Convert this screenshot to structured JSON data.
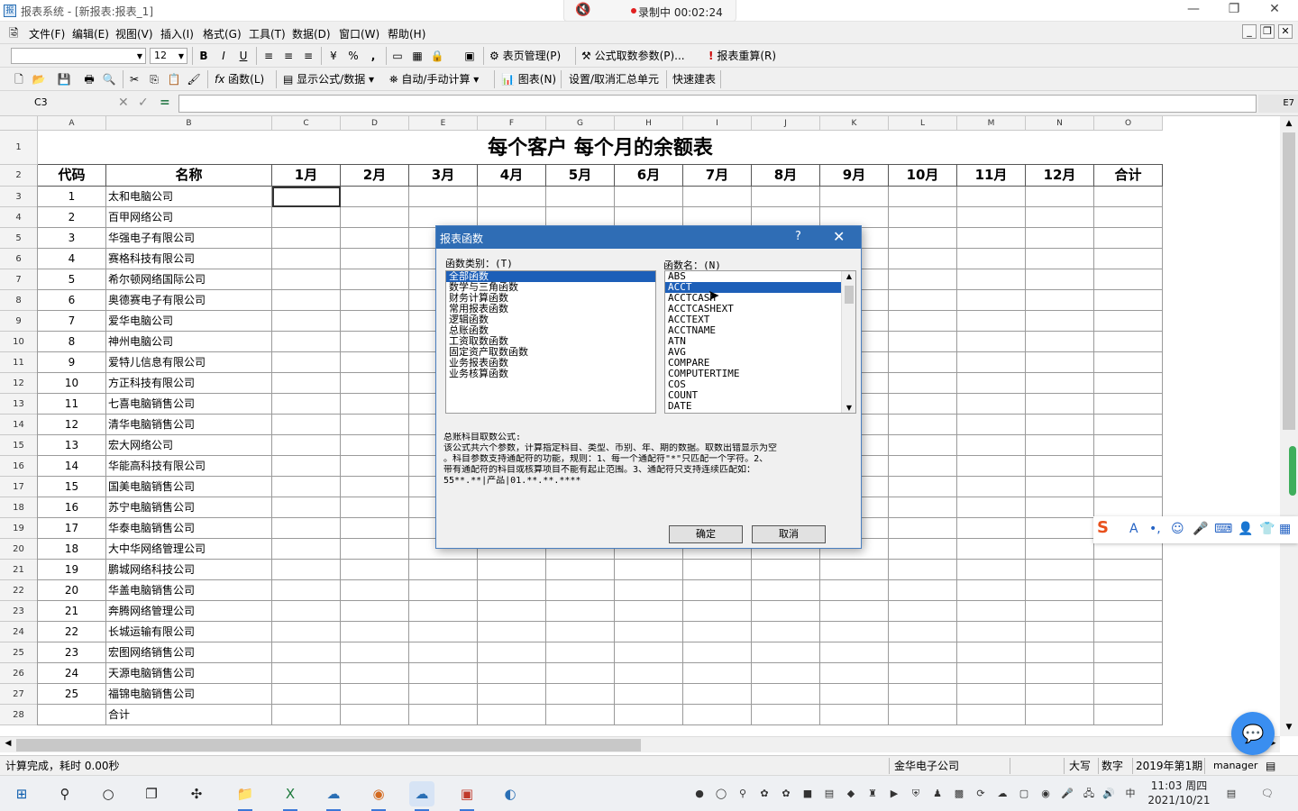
{
  "window": {
    "title": "报表系统 - [新报表:报表_1]",
    "recording_label": "录制中 00:02:24",
    "controls": [
      "—",
      "❐",
      "✕"
    ]
  },
  "menu": {
    "items": [
      "文件(F)",
      "编辑(E)",
      "视图(V)",
      "插入(I)",
      "格式(G)",
      "工具(T)",
      "数据(D)",
      "窗口(W)",
      "帮助(H)"
    ],
    "mdi_controls": [
      "_",
      "❐",
      "✕"
    ]
  },
  "toolbar1": {
    "font_size": "12",
    "page_manage": "表页管理(P)",
    "formula_params": "公式取数参数(P)...",
    "recalc": "报表重算(R)"
  },
  "toolbar2": {
    "function": "函数(L)",
    "show_formula": "显示公式/数据",
    "auto_manual": "自动/手动计算",
    "chart": "图表(N)",
    "subtotal": "设置/取消汇总单元",
    "quick_build": "快速建表"
  },
  "formula_bar": {
    "cell_ref": "C3",
    "right_ref": "E7"
  },
  "sheet": {
    "col_letters": [
      "A",
      "B",
      "C",
      "D",
      "E",
      "F",
      "G",
      "H",
      "I",
      "J",
      "K",
      "L",
      "M",
      "N",
      "O"
    ],
    "title": "每个客户    每个月的余额表",
    "headers": [
      "代码",
      "名称",
      "1月",
      "2月",
      "3月",
      "4月",
      "5月",
      "6月",
      "7月",
      "8月",
      "9月",
      "10月",
      "11月",
      "12月",
      "合计"
    ],
    "rows": [
      {
        "code": "1",
        "name": "太和电脑公司"
      },
      {
        "code": "2",
        "name": "百甲网络公司"
      },
      {
        "code": "3",
        "name": "华强电子有限公司"
      },
      {
        "code": "4",
        "name": "赛格科技有限公司"
      },
      {
        "code": "5",
        "name": "希尔顿网络国际公司"
      },
      {
        "code": "6",
        "name": "奥德赛电子有限公司"
      },
      {
        "code": "7",
        "name": "爱华电脑公司"
      },
      {
        "code": "8",
        "name": "神州电脑公司"
      },
      {
        "code": "9",
        "name": "爱特儿信息有限公司"
      },
      {
        "code": "10",
        "name": "方正科技有限公司"
      },
      {
        "code": "11",
        "name": "七喜电脑销售公司"
      },
      {
        "code": "12",
        "name": "清华电脑销售公司"
      },
      {
        "code": "13",
        "name": "宏大网络公司"
      },
      {
        "code": "14",
        "name": "华能高科技有限公司"
      },
      {
        "code": "15",
        "name": "国美电脑销售公司"
      },
      {
        "code": "16",
        "name": "苏宁电脑销售公司"
      },
      {
        "code": "17",
        "name": "华泰电脑销售公司"
      },
      {
        "code": "18",
        "name": "大中华网络管理公司"
      },
      {
        "code": "19",
        "name": "鹏城网络科技公司"
      },
      {
        "code": "20",
        "name": "华盖电脑销售公司"
      },
      {
        "code": "21",
        "name": "奔腾网络管理公司"
      },
      {
        "code": "22",
        "name": "长城运输有限公司"
      },
      {
        "code": "23",
        "name": "宏图网络销售公司"
      },
      {
        "code": "24",
        "name": "天源电脑销售公司"
      },
      {
        "code": "25",
        "name": "福锦电脑销售公司"
      },
      {
        "code": "",
        "name": "合计"
      }
    ]
  },
  "dialog": {
    "title": "报表函数",
    "help": "?",
    "close": "✕",
    "category_label": "函数类别：(T)",
    "name_label": "函数名：(N)",
    "categories": [
      "全部函数",
      "数学与三角函数",
      "财务计算函数",
      "常用报表函数",
      "逻辑函数",
      "总账函数",
      "工资取数函数",
      "固定资产取数函数",
      "业务报表函数",
      "业务核算函数"
    ],
    "selected_category": 0,
    "functions": [
      "ABS",
      "ACCT",
      "ACCTCASH",
      "ACCTCASHEXT",
      "ACCTEXT",
      "ACCTNAME",
      "ATN",
      "AVG",
      "COMPARE",
      "COMPUTERTIME",
      "COS",
      "COUNT",
      "DATE"
    ],
    "selected_function": 1,
    "description": [
      "总账科目取数公式:",
      "该公式共六个参数，计算指定科目、类型、币别、年、期的数据。取数出错显示为空",
      "。科目参数支持通配符的功能，规则：1、每一个通配符\"*\"只匹配一个字符。2、",
      "带有通配符的科目或核算项目不能有起止范围。3、通配符只支持连续匹配如：",
      "55**.**|产品|01.**.**.****"
    ],
    "ok": "确定",
    "cancel": "取消"
  },
  "status": {
    "left": "计算完成，耗时 0.00秒",
    "company": "金华电子公司",
    "caps": "大写",
    "num": "数字",
    "period": "2019年第1期",
    "user": "manager"
  },
  "taskbar": {
    "time": "11:03 周四",
    "date": "2021/10/21"
  }
}
